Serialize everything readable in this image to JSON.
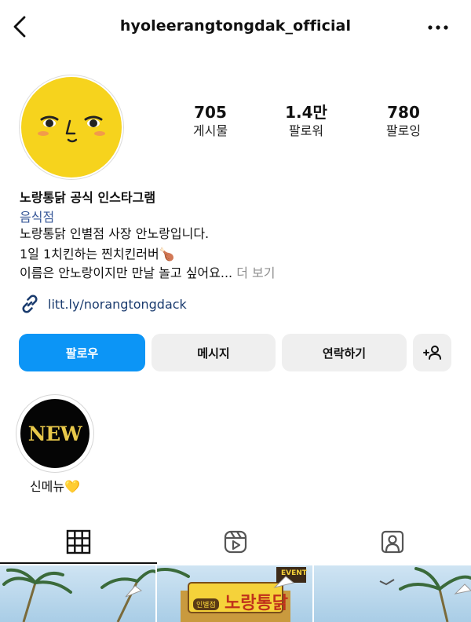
{
  "header": {
    "username": "hyoleerangtongdak_official",
    "back_icon": "chevron-left-icon",
    "more_icon": "more-horizontal-icon"
  },
  "profile": {
    "avatar_icon": "yellow-face-avatar",
    "stats": [
      {
        "value": "705",
        "label": "게시물"
      },
      {
        "value": "1.4만",
        "label": "팔로워"
      },
      {
        "value": "780",
        "label": "팔로잉"
      }
    ]
  },
  "bio": {
    "name": "노랑통닭 공식 인스타그램",
    "category": "음식점",
    "line1": "노랑통닭 인별점 사장 안노랑입니다.",
    "line2": "1일 1치킨하는 찐치킨러버🍗",
    "line3": "이름은 안노랑이지만 만날 놀고 싶어요...",
    "more": "더 보기",
    "link": "litt.ly/norangtongdack"
  },
  "actions": {
    "follow": "팔로우",
    "message": "메시지",
    "contact": "연락하기"
  },
  "highlights": [
    {
      "cover_text": "NEW",
      "label": "신메뉴💛"
    }
  ],
  "tabs": [
    {
      "icon": "grid-icon",
      "active": true
    },
    {
      "icon": "reels-icon",
      "active": false
    },
    {
      "icon": "tagged-icon",
      "active": false
    }
  ],
  "posts": {
    "banner_text": "노랑통닭",
    "badge_text": "인별점",
    "event_text": "EVENT"
  },
  "colors": {
    "follow_button": "#0c95f6",
    "secondary_button": "#efefef",
    "link": "#1a3b6e",
    "category": "#385898",
    "avatar": "#f6d31d"
  }
}
